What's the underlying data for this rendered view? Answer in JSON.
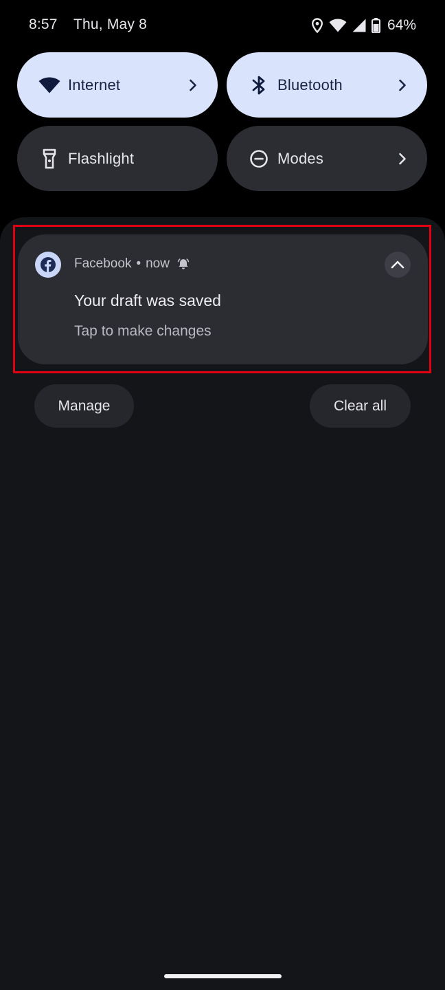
{
  "status_bar": {
    "time": "8:57",
    "date": "Thu, May 8",
    "battery_percent": "64%",
    "icons": [
      "location-icon",
      "wifi-icon",
      "cell-signal-icon",
      "battery-icon"
    ]
  },
  "quick_settings": {
    "tiles": [
      {
        "label": "Internet",
        "icon": "wifi-icon",
        "state": "active",
        "has_chevron": true
      },
      {
        "label": "Bluetooth",
        "icon": "bluetooth-icon",
        "state": "active",
        "has_chevron": true
      },
      {
        "label": "Flashlight",
        "icon": "flashlight-icon",
        "state": "inactive",
        "has_chevron": false
      },
      {
        "label": "Modes",
        "icon": "do-not-disturb-icon",
        "state": "inactive",
        "has_chevron": true
      }
    ]
  },
  "notification": {
    "app_name": "Facebook",
    "separator": "•",
    "time": "now",
    "app_icon": "facebook-icon",
    "title": "Your draft was saved",
    "text": "Tap to make changes"
  },
  "actions": {
    "manage_label": "Manage",
    "clear_all_label": "Clear all"
  },
  "colors": {
    "tile_active_bg": "#d9e3fc",
    "tile_inactive_bg": "#2c2d33",
    "shade_bg": "#141519",
    "highlight": "#e0000f"
  }
}
